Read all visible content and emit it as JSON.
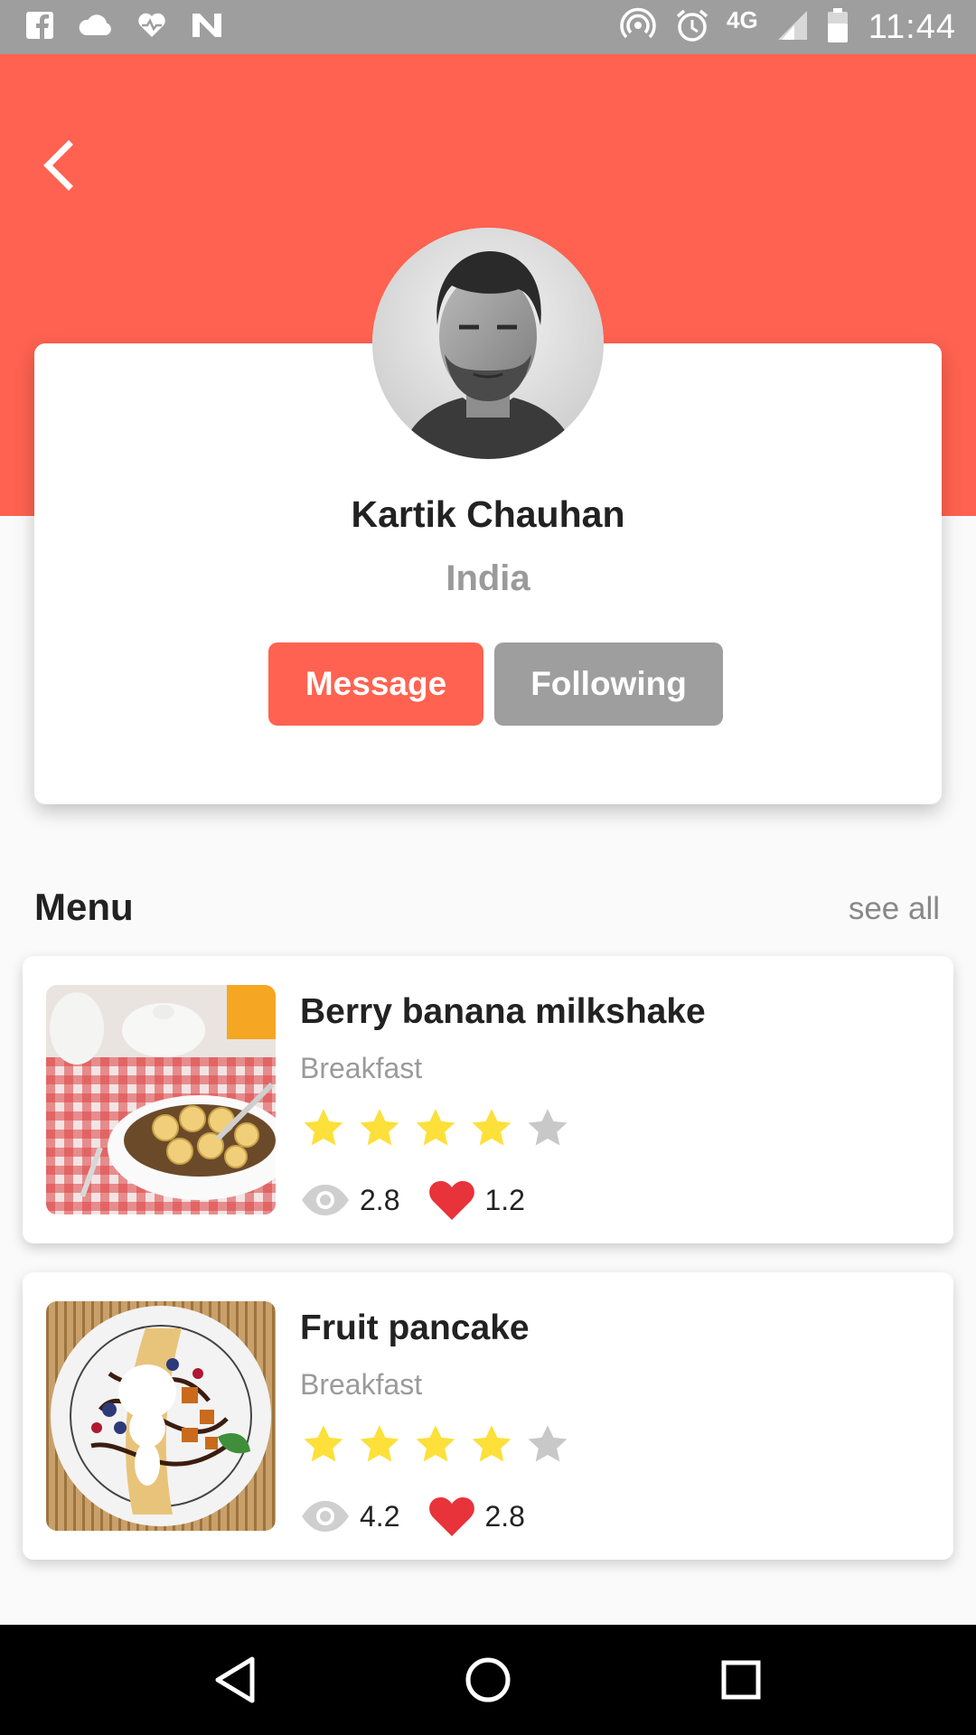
{
  "status_bar": {
    "network": "4G",
    "time": "11:44",
    "icons_left": [
      "facebook-icon",
      "cloud-icon",
      "heartbeat-icon",
      "n-icon"
    ],
    "icons_right": [
      "hotspot-icon",
      "alarm-icon",
      "signal-icon",
      "battery-icon"
    ]
  },
  "header": {
    "back_icon": "chevron-left-icon",
    "color": "#ff6250"
  },
  "profile": {
    "name": "Kartik Chauhan",
    "location": "India",
    "message_label": "Message",
    "following_label": "Following"
  },
  "menu": {
    "title": "Menu",
    "see_all": "see all",
    "items": [
      {
        "title": "Berry banana milkshake",
        "category": "Breakfast",
        "rating": 4,
        "rating_max": 5,
        "views": "2.8",
        "likes": "1.2"
      },
      {
        "title": "Fruit pancake",
        "category": "Breakfast",
        "rating": 4,
        "rating_max": 5,
        "views": "4.2",
        "likes": "2.8"
      }
    ]
  },
  "nav_bar": {
    "icons": [
      "back-triangle-icon",
      "home-circle-icon",
      "recents-square-icon"
    ]
  },
  "colors": {
    "accent": "#ff6250",
    "grey_button": "#9e9e9e",
    "star_filled": "#fde03a",
    "star_empty": "#c8c8c8",
    "heart": "#e8333a"
  }
}
